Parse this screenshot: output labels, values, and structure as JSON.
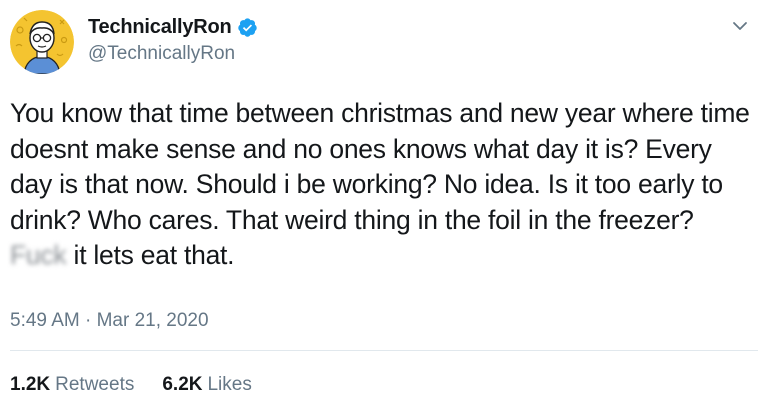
{
  "author": {
    "display_name": "TechnicallyRon",
    "handle": "@TechnicallyRon",
    "verified": true,
    "avatar_icon": "cartoon-avatar-icon"
  },
  "tweet": {
    "text_part1": "You know that time between christmas and new year where time doesnt make sense and no ones knows what day it is? Every day is that now. Should i be working? No idea. Is it too early to drink? Who cares. That weird thing in the foil in the freezer? ",
    "text_censored": "Fuck",
    "text_part2": " it lets eat that.",
    "timestamp": "5:49 AM · Mar 21, 2020"
  },
  "stats": {
    "retweets_count": "1.2K",
    "retweets_label": "Retweets",
    "likes_count": "6.2K",
    "likes_label": "Likes"
  },
  "colors": {
    "verified_blue": "#1da1f2",
    "avatar_bg": "#f4c430",
    "secondary_text": "#657786",
    "primary_text": "#14171a"
  },
  "icons": {
    "verified": "verified-badge-icon",
    "menu": "chevron-down-icon"
  }
}
